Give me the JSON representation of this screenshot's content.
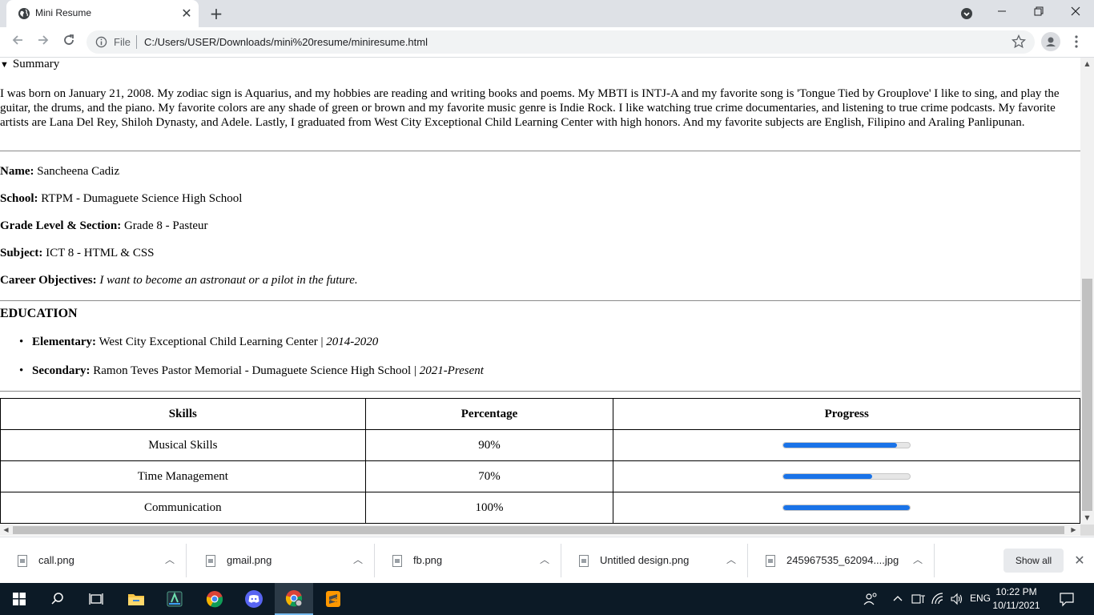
{
  "browser": {
    "tab_title": "Mini Resume",
    "new_tab_symbol": "+",
    "close_symbol": "✕",
    "file_label": "File",
    "url": "C:/Users/USER/Downloads/mini%20resume/miniresume.html"
  },
  "page": {
    "summary_label": "Summary",
    "summary_text": "I was born on January 21, 2008. My zodiac sign is Aquarius, and my hobbies are reading and writing books and poems. My MBTI is INTJ-A and my favorite song is 'Tongue Tied by Grouplove' I like to sing, and play the guitar, the drums, and the piano. My favorite colors are any shade of green or brown and my favorite music genre is Indie Rock. I like watching true crime documentaries, and listening to true crime podcasts. My favorite artists are Lana Del Rey, Shiloh Dynasty, and Adele. Lastly, I graduated from West City Exceptional Child Learning Center with high honors. And my favorite subjects are English, Filipino and Araling Panlipunan.",
    "info": {
      "name_label": "Name:",
      "name_value": "Sancheena Cadiz",
      "school_label": "School:",
      "school_value": "RTPM - Dumaguete Science High School",
      "grade_label": "Grade Level & Section:",
      "grade_value": "Grade 8 - Pasteur",
      "subject_label": "Subject:",
      "subject_value": "ICT 8 - HTML & CSS",
      "career_label": "Career Objectives:",
      "career_value": "I want to become an astronaut or a pilot in the future."
    },
    "education": {
      "heading": "EDUCATION",
      "items": [
        {
          "label": "Elementary:",
          "school": "West City Exceptional Child Learning Center |",
          "years": "2014-2020"
        },
        {
          "label": "Secondary:",
          "school": "Ramon Teves Pastor Memorial - Dumaguete Science High School |",
          "years": "2021-Present"
        }
      ]
    },
    "skills_table": {
      "headers": [
        "Skills",
        "Percentage",
        "Progress"
      ],
      "rows": [
        {
          "skill": "Musical Skills",
          "percentage": "90%",
          "progress": 0.9
        },
        {
          "skill": "Time Management",
          "percentage": "70%",
          "progress": 0.7
        },
        {
          "skill": "Communication",
          "percentage": "100%",
          "progress": 1.0
        }
      ],
      "progress_color": "#1a73e8"
    }
  },
  "downloads": {
    "items": [
      "call.png",
      "gmail.png",
      "fb.png",
      "Untitled design.png",
      "245967535_62094....jpg"
    ],
    "show_all": "Show all"
  },
  "taskbar": {
    "language": "ENG",
    "time": "10:22 PM",
    "date": "10/11/2021"
  }
}
